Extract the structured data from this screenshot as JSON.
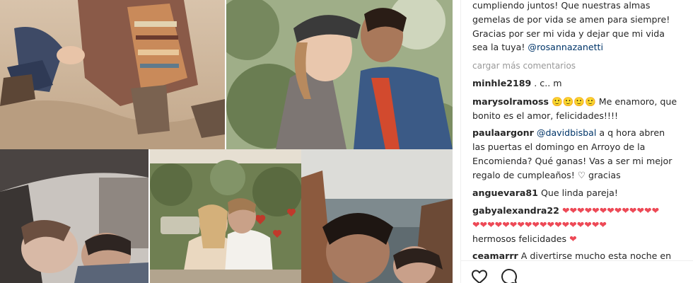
{
  "caption": {
    "line1": "cumpliendo juntos! Que nuestras almas",
    "line2": "gemelas de por vida se amen para siempre!",
    "line3": "Gracias por ser mi vida y dejar que mi vida",
    "line4_text": "sea la tuya! ",
    "mention": "@rosannazanetti"
  },
  "load_more": "cargar más comentarios",
  "comments": [
    {
      "user": "minhle2189",
      "text": " . c.. m"
    },
    {
      "user": "marysolramoss",
      "emojis": "🙂🙂🙂🙂",
      "text_line1": " Me enamoro, que",
      "text_line2": "bonito es el amor, felicidades!!!!"
    },
    {
      "user": "paulaargonr",
      "mention": "@davidbisbal",
      "text_line1": " a q hora abren",
      "text_line2": "las puertas el domingo en Arroyo de la",
      "text_line3": "Encomienda? Qué ganas! Vas a ser mi mejor",
      "text_line4": "regalo de cumpleaños! ♡ gracias"
    },
    {
      "user": "anguevara81",
      "text": " Que linda pareja!"
    },
    {
      "user": "gabyalexandra22",
      "hearts_line1": " ❤❤❤❤❤❤❤❤❤❤❤❤❤",
      "hearts_line2": "❤❤❤❤❤❤❤❤❤❤❤❤❤❤❤❤❤❤",
      "text_line3": "hermosos felicidades ",
      "heart_end": "❤"
    },
    {
      "user": "ceamarrr",
      "text": " A divertirse mucho esta noche en"
    }
  ],
  "colors": {
    "text": "#262626",
    "mention": "#003569",
    "muted": "#999999",
    "heart": "#ed4956"
  },
  "icons": [
    "heart-outline-icon",
    "speech-bubble-icon"
  ]
}
